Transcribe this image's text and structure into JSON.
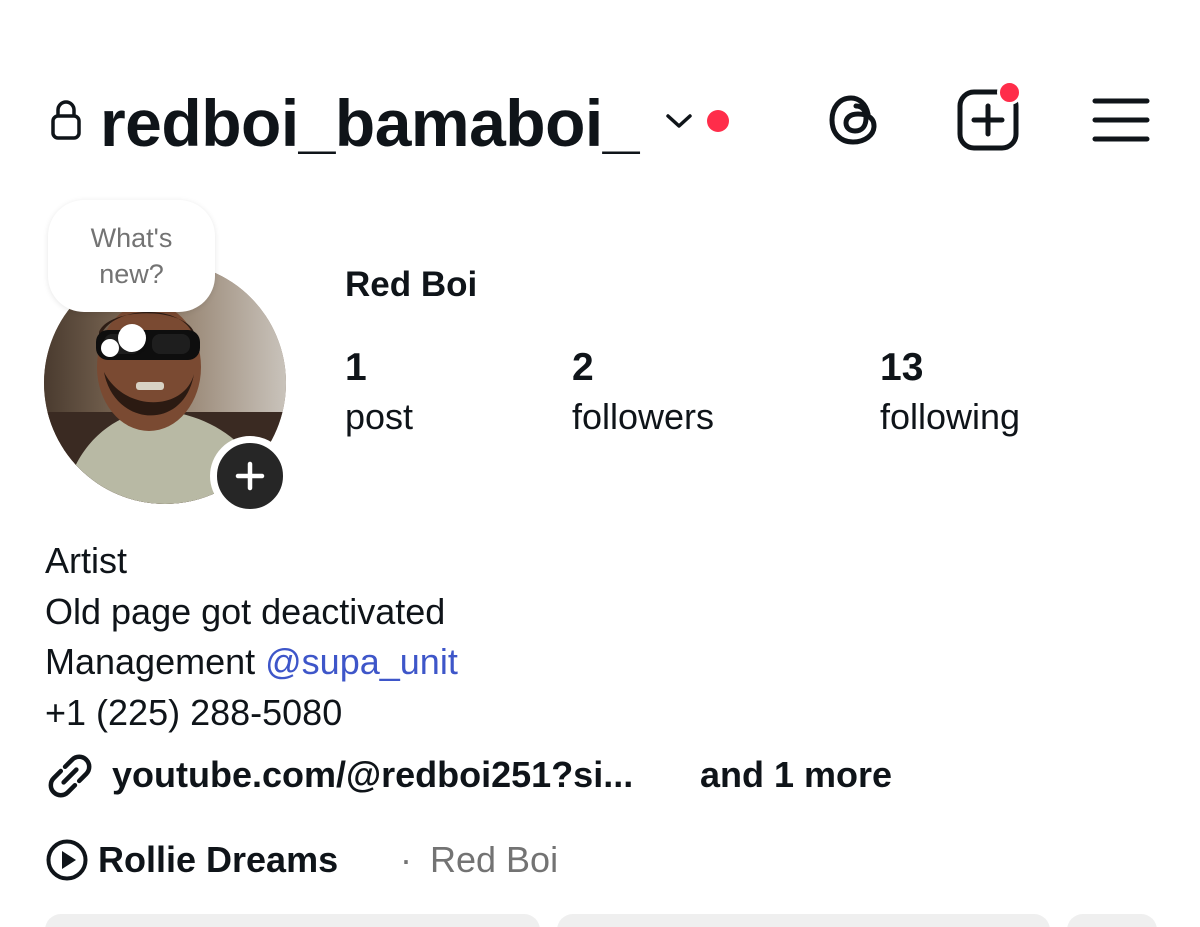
{
  "header": {
    "username": "redboi_bamaboi_",
    "icons": {
      "lock": "lock-icon",
      "chevron": "chevron-down-icon",
      "threads": "threads-icon",
      "create": "plus-square-icon",
      "menu": "hamburger-menu-icon"
    },
    "notification_dot_color": "#ff2d4a"
  },
  "note": {
    "placeholder": "What's new?"
  },
  "profile": {
    "display_name": "Red Boi",
    "stats": [
      {
        "count": "1",
        "label": "post"
      },
      {
        "count": "2",
        "label": "followers"
      },
      {
        "count": "13",
        "label": "following"
      }
    ]
  },
  "bio": {
    "line1": "Artist",
    "line2": "Old page got deactivated",
    "line3_prefix": "Management ",
    "line3_mention": "@supa_unit",
    "line4": "+1 (225) 288-5080",
    "mention_color": "#3e56c9"
  },
  "links": {
    "primary": "youtube.com/@redboi251?si...",
    "more": "and 1 more",
    "icon": "link-icon"
  },
  "music": {
    "title": "Rollie Dreams",
    "separator": "·",
    "artist": "Red Boi",
    "icon": "play-circle-icon"
  }
}
